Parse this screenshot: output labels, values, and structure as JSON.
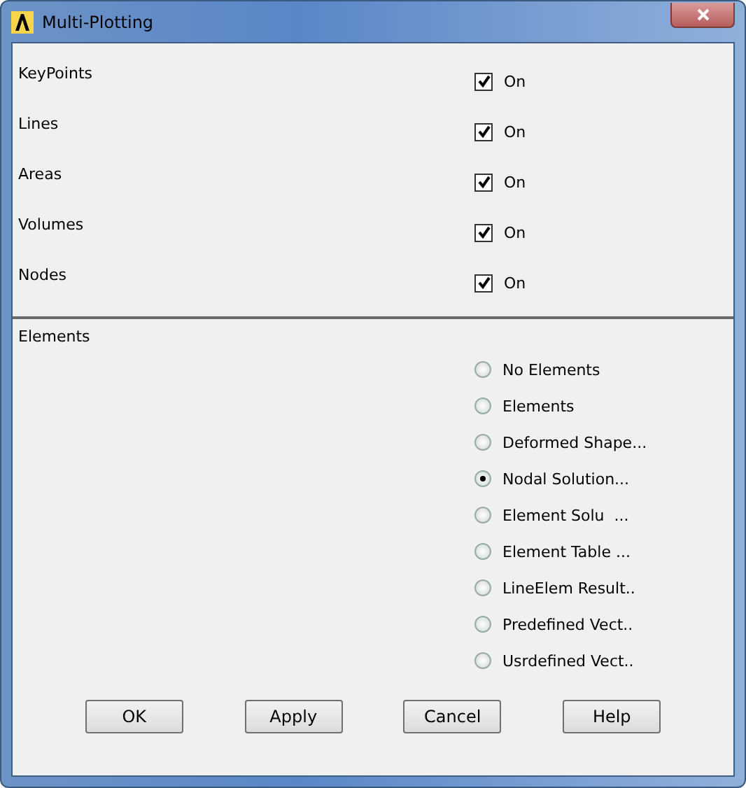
{
  "window": {
    "title": "Multi-Plotting"
  },
  "toggles": [
    {
      "label": "KeyPoints",
      "checked": true,
      "text": "On"
    },
    {
      "label": "Lines",
      "checked": true,
      "text": "On"
    },
    {
      "label": "Areas",
      "checked": true,
      "text": "On"
    },
    {
      "label": "Volumes",
      "checked": true,
      "text": "On"
    },
    {
      "label": "Nodes",
      "checked": true,
      "text": "On"
    }
  ],
  "elements": {
    "label": "Elements",
    "options": [
      {
        "label": "No Elements",
        "selected": false
      },
      {
        "label": "Elements",
        "selected": false
      },
      {
        "label": "Deformed Shape...",
        "selected": false
      },
      {
        "label": "Nodal Solution...",
        "selected": true
      },
      {
        "label": "Element Solu  ...",
        "selected": false
      },
      {
        "label": "Element Table ...",
        "selected": false
      },
      {
        "label": "LineElem Result..",
        "selected": false
      },
      {
        "label": "Predefined Vect..",
        "selected": false
      },
      {
        "label": "Usrdefined Vect..",
        "selected": false
      }
    ]
  },
  "buttons": [
    "OK",
    "Apply",
    "Cancel",
    "Help"
  ]
}
